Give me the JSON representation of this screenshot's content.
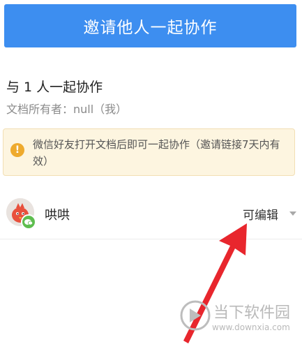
{
  "invite_button": {
    "label": "邀请他人一起协作"
  },
  "collab": {
    "heading": "与 1 人一起协作",
    "owner": "文档所有者：null（我）"
  },
  "notice": {
    "icon": "!",
    "text": "微信好友打开文档后即可一起协作（邀请链接7天内有效）"
  },
  "member": {
    "name": "哄哄",
    "permission": "可编辑",
    "avatar_icon": "red-bird-avatar",
    "badge_icon": "wechat-icon"
  },
  "watermark": {
    "title": "当下软件园",
    "url": "www.downxia.com"
  },
  "colors": {
    "primary": "#3d8ef0",
    "notice_bg": "#fdf5e0",
    "notice_icon": "#eeaa2e",
    "annotation_arrow": "#e8262d"
  }
}
